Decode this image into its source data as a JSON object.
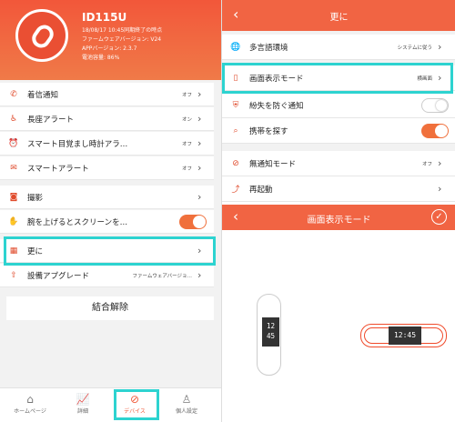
{
  "device": {
    "name": "ID115U",
    "info_lines": [
      "18/08/17 10:45同期終了の時点",
      "ファームウェアバージョン: V24",
      "APPバージョン: 2.3.7",
      "電池容量: 86%"
    ]
  },
  "left_menu": [
    {
      "label": "着信通知",
      "value": "オフ",
      "icon": "phone-icon"
    },
    {
      "label": "長座アラート",
      "value": "オン",
      "icon": "sitting-icon"
    },
    {
      "label": "スマート目覚まし時計アラ…",
      "value": "オフ",
      "icon": "alarm-clock-icon"
    },
    {
      "label": "スマートアラート",
      "value": "オフ",
      "icon": "message-icon"
    },
    {
      "label": "撮影",
      "value": "",
      "icon": "camera-icon"
    },
    {
      "label": "腕を上げるとスクリーンを…",
      "value": "",
      "icon": "wrist-icon",
      "toggle": "on"
    },
    {
      "label": "更に",
      "value": "",
      "icon": "more-icon"
    },
    {
      "label": "設備アプグレード",
      "value": "ファームウェアバージョ…",
      "icon": "upgrade-icon"
    }
  ],
  "unbind_label": "結合解除",
  "tabs": [
    {
      "label": "ホームページ",
      "icon": "home-icon"
    },
    {
      "label": "詳細",
      "icon": "chart-icon"
    },
    {
      "label": "デバイス",
      "icon": "device-icon",
      "active": true
    },
    {
      "label": "個人設定",
      "icon": "person-icon"
    }
  ],
  "right": {
    "title": "更に",
    "rows": [
      {
        "label": "多言語環境",
        "value": "システムに従う",
        "icon": "globe-icon"
      },
      {
        "label": "画面表示モード",
        "value": "横画面",
        "icon": "display-icon"
      },
      {
        "label": "紛失を防ぐ通知",
        "value": "",
        "icon": "shield-icon",
        "toggle": "off"
      },
      {
        "label": "携帯を探す",
        "value": "",
        "icon": "search-icon",
        "toggle": "on"
      },
      {
        "label": "無通知モード",
        "value": "オフ",
        "icon": "mute-icon"
      },
      {
        "label": "再起動",
        "value": "",
        "icon": "restart-icon"
      }
    ],
    "mode_title": "画面表示モード",
    "time_vertical": [
      "12",
      "45"
    ],
    "time_horizontal": "12:45"
  },
  "colors": {
    "accent": "#f16443",
    "highlight": "#2dd3d0"
  }
}
